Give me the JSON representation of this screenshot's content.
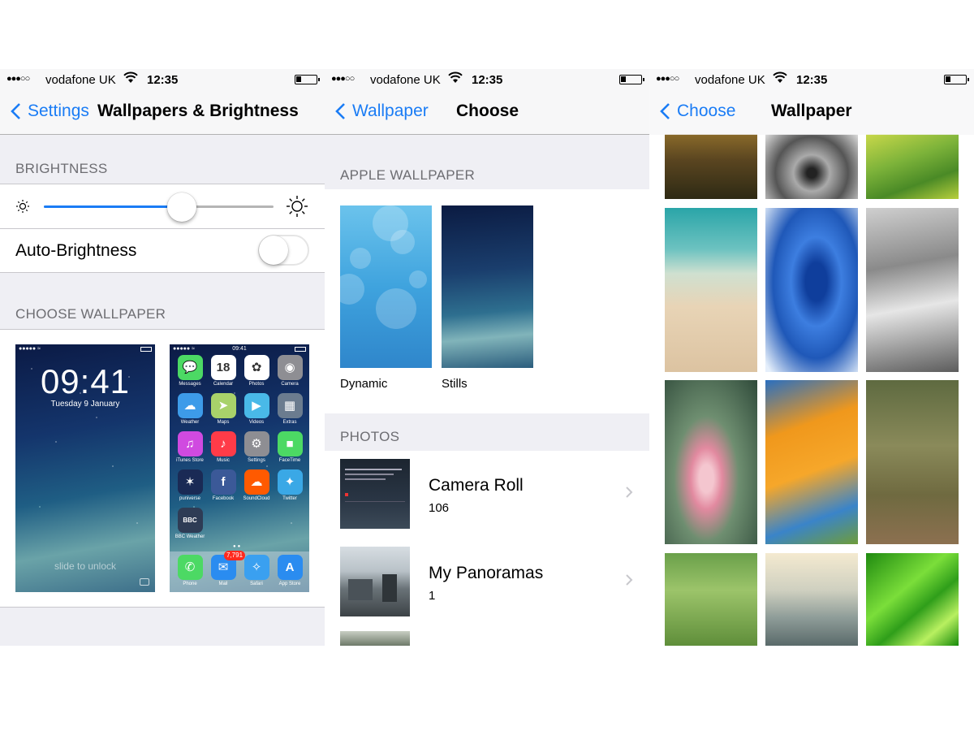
{
  "status": {
    "carrier": "vodafone UK",
    "time": "12:35"
  },
  "screen1": {
    "back_label": "Settings",
    "title": "Wallpapers & Brightness",
    "brightness_header": "BRIGHTNESS",
    "brightness_level": 0.6,
    "auto_brightness_label": "Auto-Brightness",
    "auto_brightness_on": false,
    "choose_header": "CHOOSE WALLPAPER",
    "lock_preview": {
      "time": "09:41",
      "date": "Tuesday 9 January",
      "slide": "slide to unlock"
    },
    "home_preview": {
      "time": "09:41",
      "apps": [
        {
          "name": "Messages",
          "icon": "messages-icon",
          "color": "#4cd964",
          "glyph": "💬"
        },
        {
          "name": "Calendar",
          "icon": "calendar-icon",
          "color": "#ffffff",
          "glyph": "18"
        },
        {
          "name": "Photos",
          "icon": "photos-icon",
          "color": "#ffffff",
          "glyph": "✿"
        },
        {
          "name": "Camera",
          "icon": "camera-icon",
          "color": "#8e8e93",
          "glyph": "◉"
        },
        {
          "name": "Weather",
          "icon": "weather-icon",
          "color": "#3d9be9",
          "glyph": "☁"
        },
        {
          "name": "Maps",
          "icon": "maps-icon",
          "color": "#a8d26a",
          "glyph": "➤"
        },
        {
          "name": "Videos",
          "icon": "videos-icon",
          "color": "#49b9e8",
          "glyph": "▶"
        },
        {
          "name": "Extras",
          "icon": "folder-icon",
          "color": "#6b7c8f",
          "glyph": "▦"
        },
        {
          "name": "iTunes Store",
          "icon": "itunes-icon",
          "color": "#d04ae0",
          "glyph": "♫"
        },
        {
          "name": "Music",
          "icon": "music-icon",
          "color": "#ff3b48",
          "glyph": "♪"
        },
        {
          "name": "Settings",
          "icon": "settings-icon",
          "color": "#8e8e93",
          "glyph": "⚙"
        },
        {
          "name": "FaceTime",
          "icon": "facetime-icon",
          "color": "#4cd964",
          "glyph": "■"
        },
        {
          "name": "puniverse",
          "icon": "universe-icon",
          "color": "#1a2a55",
          "glyph": "✶"
        },
        {
          "name": "Facebook",
          "icon": "facebook-icon",
          "color": "#3b5998",
          "glyph": "f"
        },
        {
          "name": "SoundCloud",
          "icon": "soundcloud-icon",
          "color": "#ff5a00",
          "glyph": "☁"
        },
        {
          "name": "Twitter",
          "icon": "twitter-icon",
          "color": "#3aa8e6",
          "glyph": "✦"
        },
        {
          "name": "BBC Weather",
          "icon": "bbc-weather-icon",
          "color": "#2e3c55",
          "glyph": "BBC"
        }
      ],
      "dock": [
        {
          "name": "Phone",
          "icon": "phone-icon",
          "color": "#4cd964",
          "glyph": "✆"
        },
        {
          "name": "Mail",
          "icon": "mail-icon",
          "color": "#2a8cf0",
          "glyph": "✉",
          "badge": "7,791"
        },
        {
          "name": "Safari",
          "icon": "safari-icon",
          "color": "#3aa0f0",
          "glyph": "✧"
        },
        {
          "name": "App Store",
          "icon": "app-store-icon",
          "color": "#2a8cf0",
          "glyph": "A"
        }
      ]
    }
  },
  "screen2": {
    "back_label": "Wallpaper",
    "title": "Choose",
    "apple_header": "APPLE WALLPAPER",
    "categories": [
      "Dynamic",
      "Stills"
    ],
    "photos_header": "PHOTOS",
    "albums": [
      {
        "name": "Camera Roll",
        "count": "106"
      },
      {
        "name": "My Panoramas",
        "count": "1"
      }
    ]
  },
  "screen3": {
    "back_label": "Choose",
    "title": "Wallpaper",
    "tiles": [
      {
        "name": "sunset-field",
        "bg": "linear-gradient(180deg,#8a6a2a 0%,#5a4520 40%,#2e2a14 100%)"
      },
      {
        "name": "pebbles-bw",
        "bg": "radial-gradient(circle at 50% 60%,#222 8%,#aaa 30%,#555 60%,#ddd 100%)"
      },
      {
        "name": "rice-terrace",
        "bg": "linear-gradient(160deg,#c9d84a 0%,#7db33a 40%,#4a8a26 70%,#b8cf3c 100%)"
      },
      {
        "name": "beach-shore",
        "bg": "linear-gradient(180deg,#2aa5a8 0%,#6cc2c0 25%,#cfe0d0 40%,#e8d4b6 60%,#dcc3a1 100%)"
      },
      {
        "name": "blue-wave",
        "bg": "radial-gradient(ellipse at 55% 45%,#0f3e9c 15%,#3d7ee0 35%,#1f58b8 60%,#e5effb 95%)"
      },
      {
        "name": "wave-bw",
        "bg": "linear-gradient(170deg,#cfcfcf 0%,#8a8a8a 35%,#e6e6e6 60%,#5c5c5c 100%)"
      },
      {
        "name": "water-lily",
        "bg": "radial-gradient(ellipse at 45% 60%,#f4c6cf 10%,#e28aa0 22%,#6e8e70 45%,#2f4a3a 100%)"
      },
      {
        "name": "orange-poppies",
        "bg": "linear-gradient(160deg,#2a6fc0 0%,#f0981c 30%,#f6a72a 55%,#3a84c9 80%,#6e9c3a 100%)"
      },
      {
        "name": "yellow-flowers",
        "bg": "linear-gradient(180deg,#5e6a40 0%,#8a8a5a 40%,#6f6a40 70%,#8c7050 100%)"
      },
      {
        "name": "dew-grass",
        "bg": "linear-gradient(180deg,#6aa04a 0%,#9cc46a 40%,#5f8e3a 100%)"
      },
      {
        "name": "reeds-sunlight",
        "bg": "linear-gradient(180deg,#f4ead0 0%,#cfd0c0 40%,#8e9c98 70%,#5a6a6a 100%)"
      },
      {
        "name": "green-leaf",
        "bg": "linear-gradient(140deg,#1f8a10 0%,#7bde3a 40%,#2f9e1a 60%,#b8f060 80%,#168a0a 100%)"
      }
    ]
  }
}
